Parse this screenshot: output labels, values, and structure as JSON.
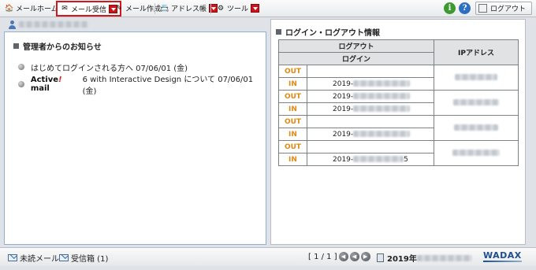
{
  "toolbar": {
    "items": [
      {
        "label": "メールホーム",
        "icon": "mail-home-icon"
      },
      {
        "label": "メール受信",
        "icon": "mail-receive-icon",
        "active": true
      },
      {
        "label": "メール作成",
        "icon": "mail-compose-icon"
      },
      {
        "label": "アドレス帳",
        "icon": "address-book-icon"
      },
      {
        "label": "ツール",
        "icon": "tools-icon"
      }
    ],
    "info_icon": "i",
    "help_icon": "?",
    "logout_label": "ログアウト",
    "colors": {
      "active_border": "#d4171b",
      "dropdown": "#c9141a",
      "info": "#3d9a2f",
      "help": "#2d6fc0"
    }
  },
  "news": {
    "title": "管理者からのお知らせ",
    "items": [
      {
        "text": "はじめてログインされる方へ 07/06/01 (金)"
      },
      {
        "brand_a": "Active",
        "brand_b": "!",
        "brand_c": " mail",
        "text": " 6 with Interactive Design について 07/06/01 (金)"
      }
    ]
  },
  "login_log": {
    "title": "ログイン・ログアウト情報",
    "headers": {
      "logout": "ログアウト",
      "login": "ログイン",
      "ip": "IPアドレス"
    },
    "rows": [
      {
        "tag": "OUT",
        "date": ""
      },
      {
        "tag": "IN",
        "date": "2019-"
      },
      {
        "tag": "OUT",
        "date": "2019-"
      },
      {
        "tag": "IN",
        "date": "2019-"
      },
      {
        "tag": "OUT",
        "date": ""
      },
      {
        "tag": "IN",
        "date": "2019-"
      },
      {
        "tag": "OUT",
        "date": ""
      },
      {
        "tag": "IN",
        "date": "2019-"
      }
    ],
    "last_row_suffix": "5",
    "tag_color": "#e08a12"
  },
  "status": {
    "unread_label": "未読メール",
    "inbox_label": "受信箱 (1)",
    "pager": "[ 1 / 1 ]",
    "date_prefix": "2019年",
    "logo": "WADAX"
  }
}
